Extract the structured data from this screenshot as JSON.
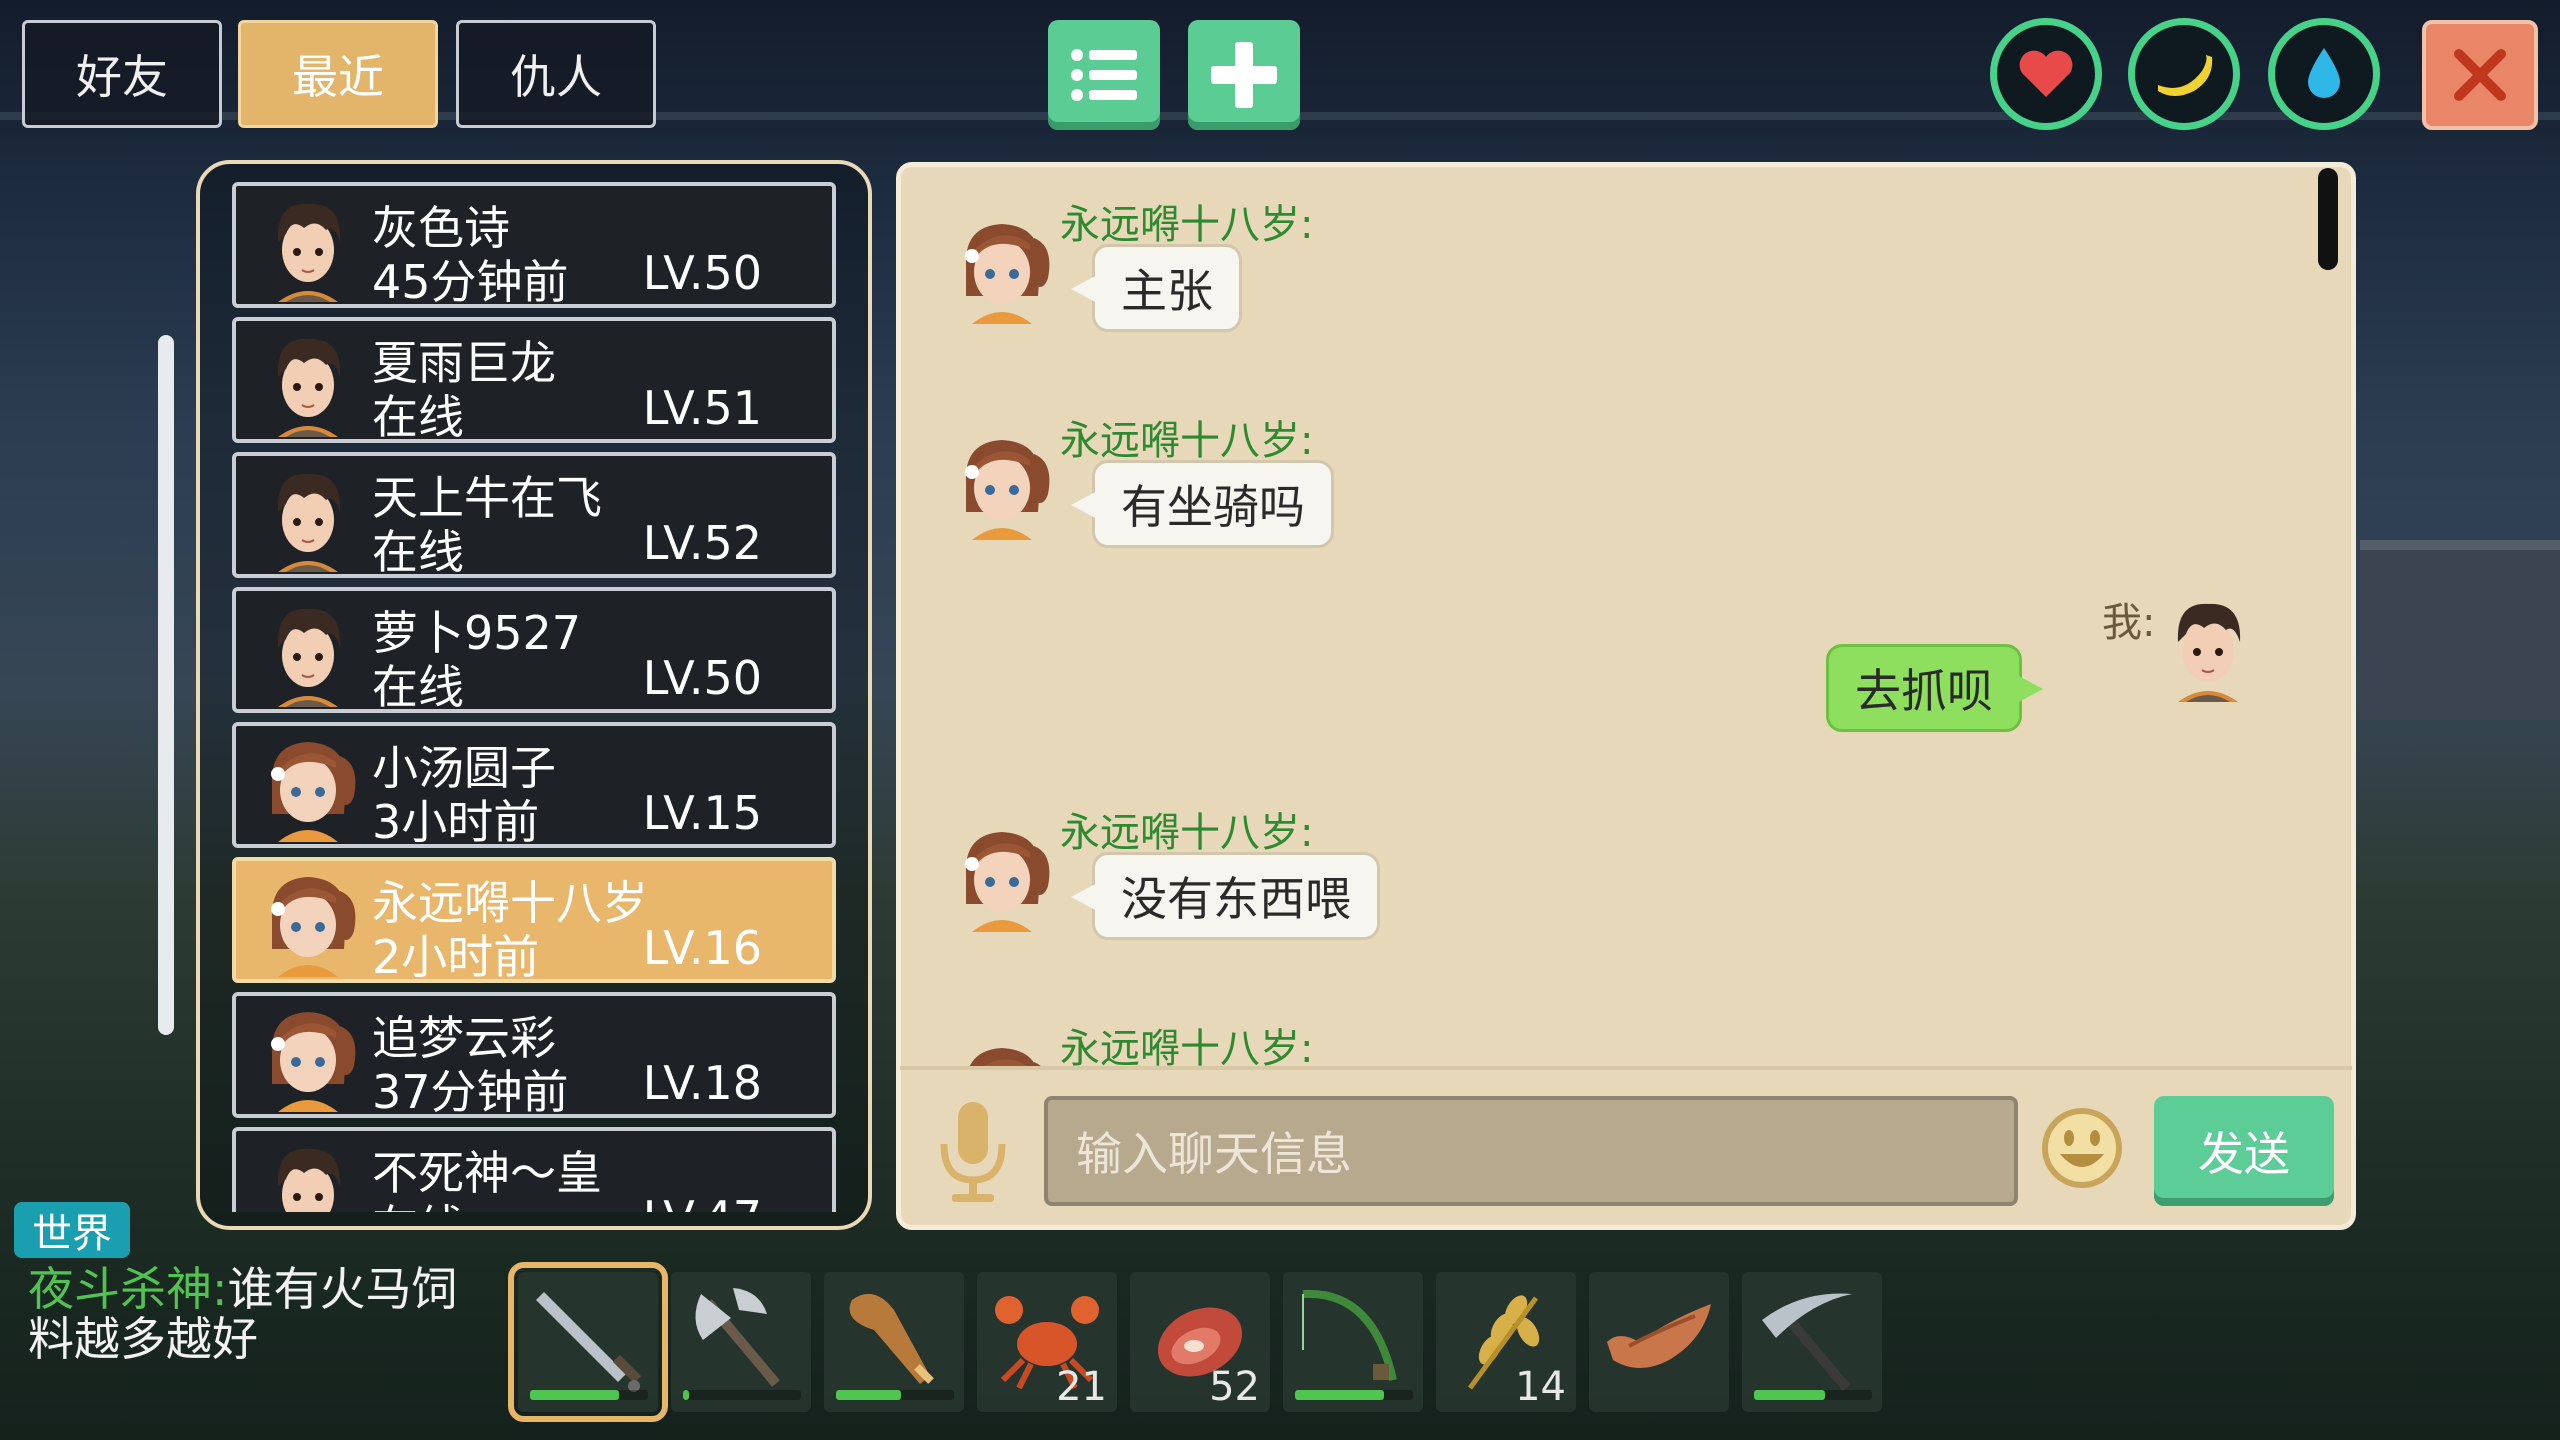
{
  "tabs": {
    "friends": "好友",
    "recent": "最近",
    "enemies": "仇人"
  },
  "top_buttons": {
    "list_icon": "list-icon",
    "add_icon": "plus-icon"
  },
  "status_icons": [
    "heart-icon",
    "banana-icon",
    "water-drop-icon"
  ],
  "friends": [
    {
      "name": "灰色诗",
      "status": "45分钟前",
      "level": "LV.50",
      "avatar": "boy"
    },
    {
      "name": "夏雨巨龙",
      "status": "在线",
      "level": "LV.51",
      "avatar": "boy"
    },
    {
      "name": "天上牛在飞",
      "status": "在线",
      "level": "LV.52",
      "avatar": "boy"
    },
    {
      "name": "萝卜9527",
      "status": "在线",
      "level": "LV.50",
      "avatar": "boy"
    },
    {
      "name": "小汤圆子",
      "status": "3小时前",
      "level": "LV.15",
      "avatar": "girl"
    },
    {
      "name": "永远嘚十八岁",
      "status": "2小时前",
      "level": "LV.16",
      "avatar": "girl",
      "selected": true
    },
    {
      "name": "追梦云彩",
      "status": "37分钟前",
      "level": "LV.18",
      "avatar": "girl"
    },
    {
      "name": "不死神～皇",
      "status": "在线",
      "level": "LV.47",
      "avatar": "boy"
    }
  ],
  "messages": [
    {
      "sender": "永远嘚十八岁:",
      "text": "主张",
      "me": false
    },
    {
      "sender": "永远嘚十八岁:",
      "text": "有坐骑吗",
      "me": false
    },
    {
      "sender": "我:",
      "text": "去抓呗",
      "me": true
    },
    {
      "sender": "永远嘚十八岁:",
      "text": "没有东西喂",
      "me": false
    },
    {
      "sender": "永远嘚十八岁:",
      "text": "",
      "me": false
    }
  ],
  "input": {
    "placeholder": "输入聊天信息",
    "send_label": "发送"
  },
  "world": {
    "tag": "世界",
    "sender": "夜斗杀神",
    "separator": ":",
    "text": "谁有火马饲料越多越好"
  },
  "hotbar": [
    {
      "item": "sword-icon",
      "durability": 0.75
    },
    {
      "item": "axe-icon",
      "durability": 0.05
    },
    {
      "item": "club-icon",
      "durability": 0.55
    },
    {
      "item": "crab-icon",
      "count": "21"
    },
    {
      "item": "meat-icon",
      "count": "52"
    },
    {
      "item": "fishing-rod-icon",
      "durability": 0.75
    },
    {
      "item": "wheat-icon",
      "count": "14"
    },
    {
      "item": "boat-icon"
    },
    {
      "item": "pickaxe-icon",
      "durability": 0.6
    }
  ],
  "colors": {
    "accent": "#e3b56b",
    "green_button": "#5bcd94",
    "chat_bg": "#e7d8ba",
    "sender_green": "#2e8a2e",
    "my_bubble": "#8fdf5e"
  }
}
